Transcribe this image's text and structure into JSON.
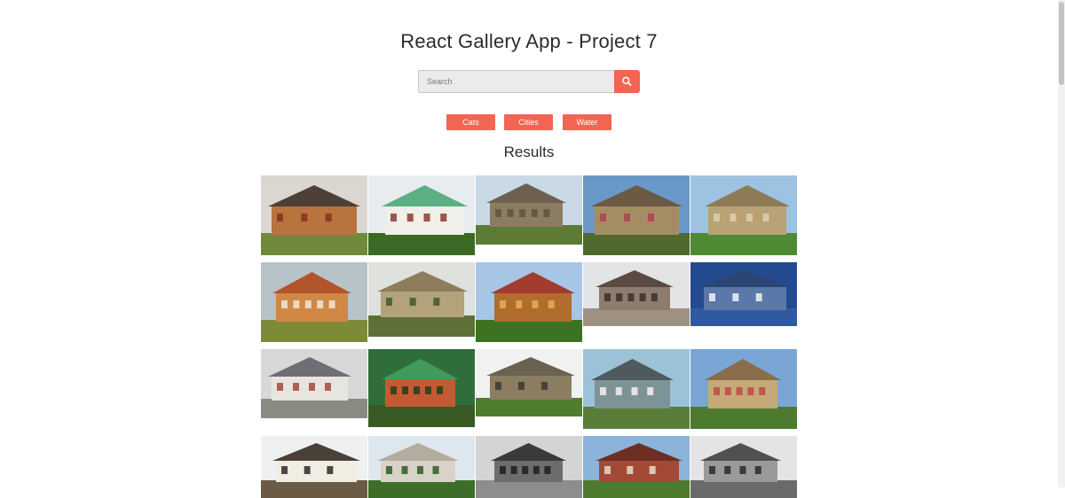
{
  "header": {
    "title": "React Gallery App - Project 7"
  },
  "search": {
    "placeholder": "Search",
    "value": "",
    "button_icon": "search-icon"
  },
  "nav": {
    "links": [
      "Cats",
      "Cities",
      "Water"
    ]
  },
  "results": {
    "heading": "Results"
  },
  "colors": {
    "accent": "#f36452",
    "text": "#2c2c2c",
    "input_bg": "#ebebeb"
  },
  "gallery": {
    "photos": [
      {
        "name": "photo-cottage-thatched",
        "palette": {
          "sky": "#d9d7cf",
          "wall": "#b8733f",
          "roof": "#4e4038",
          "ground": "#6f8a3d",
          "accent": "#8a2f22"
        }
      },
      {
        "name": "photo-house-green-roof",
        "palette": {
          "sky": "#e8ecef",
          "wall": "#f0efe9",
          "roof": "#5bb083",
          "ground": "#3c6a24",
          "accent": "#8d3b33"
        }
      },
      {
        "name": "photo-manor-stone",
        "palette": {
          "sky": "#c9d9e6",
          "wall": "#8c7d62",
          "roof": "#6c6150",
          "ground": "#5d7b35",
          "accent": "#5c5444"
        }
      },
      {
        "name": "photo-mansion-garden",
        "palette": {
          "sky": "#6a98c9",
          "wall": "#a58d63",
          "roof": "#6b5a44",
          "ground": "#4f6a2c",
          "accent": "#b23f52"
        }
      },
      {
        "name": "photo-hall-lawn",
        "palette": {
          "sky": "#9ec2e2",
          "wall": "#b9a273",
          "roof": "#8e7a55",
          "ground": "#4f8a34",
          "accent": "#d9cfb6"
        }
      },
      {
        "name": "photo-house-red-roof",
        "palette": {
          "sky": "#b8c3c8",
          "wall": "#d08844",
          "roof": "#b2542c",
          "ground": "#7d8a38",
          "accent": "#f0e8dc"
        }
      },
      {
        "name": "photo-palace-terrace",
        "palette": {
          "sky": "#dfe1dc",
          "wall": "#b4a27c",
          "roof": "#8d7d5d",
          "ground": "#5d7035",
          "accent": "#3d5a26"
        }
      },
      {
        "name": "photo-chalet-wooden",
        "palette": {
          "sky": "#a7c6e6",
          "wall": "#b26c2e",
          "roof": "#a23c2e",
          "ground": "#3d7223",
          "accent": "#e0b055"
        }
      },
      {
        "name": "photo-ruin-brick",
        "palette": {
          "sky": "#e2e4e6",
          "wall": "#8e7c6e",
          "roof": "#5a4a42",
          "ground": "#9f9181",
          "accent": "#37312c"
        }
      },
      {
        "name": "photo-beach-house-blue",
        "palette": {
          "sky": "#234a8d",
          "wall": "#5a78a8",
          "roof": "#2d4574",
          "ground": "#2f5aa0",
          "accent": "#f2f3f5"
        }
      },
      {
        "name": "photo-village-roofs",
        "palette": {
          "sky": "#d8d9d7",
          "wall": "#e7e5df",
          "roof": "#6e6e74",
          "ground": "#8a8a82",
          "accent": "#a64a3c"
        }
      },
      {
        "name": "photo-house-green-shingle",
        "palette": {
          "sky": "#2f6e3b",
          "wall": "#c45a33",
          "roof": "#3f9a5b",
          "ground": "#3a5a25",
          "accent": "#263e1a"
        }
      },
      {
        "name": "photo-estate-distant",
        "palette": {
          "sky": "#f0f1f1",
          "wall": "#8a7d60",
          "roof": "#6b6150",
          "ground": "#4f7d2e",
          "accent": "#3a3a30"
        }
      },
      {
        "name": "photo-house-grey-siding",
        "palette": {
          "sky": "#9cc2d8",
          "wall": "#7e9398",
          "roof": "#4e5a5e",
          "ground": "#5b7d3a",
          "accent": "#f1f2ee"
        }
      },
      {
        "name": "photo-tudor-mansion",
        "palette": {
          "sky": "#7aa6d6",
          "wall": "#c6a978",
          "roof": "#8a6e4c",
          "ground": "#4d7a2e",
          "accent": "#c04848"
        }
      },
      {
        "name": "photo-tudor-cottage",
        "palette": {
          "sky": "#eef0f1",
          "wall": "#f2ede2",
          "roof": "#4a4038",
          "ground": "#6b5a45",
          "accent": "#2e2a26"
        }
      },
      {
        "name": "photo-castle-white",
        "palette": {
          "sky": "#dfe7ee",
          "wall": "#d8d3c6",
          "roof": "#b3ad9f",
          "ground": "#3c6e2a",
          "accent": "#2e5a23"
        }
      },
      {
        "name": "photo-log-cabin",
        "palette": {
          "sky": "#d4d4d4",
          "wall": "#6d6d6d",
          "roof": "#3a3a3a",
          "ground": "#8d8d8d",
          "accent": "#1f1f1f"
        }
      },
      {
        "name": "photo-brick-hall",
        "palette": {
          "sky": "#8cb3d9",
          "wall": "#a24a36",
          "roof": "#6d2f24",
          "ground": "#4f7a2e",
          "accent": "#e5dccb"
        }
      },
      {
        "name": "photo-barn-bw",
        "palette": {
          "sky": "#e4e4e4",
          "wall": "#9a9a9a",
          "roof": "#505050",
          "ground": "#6a6a6a",
          "accent": "#2a2a2a"
        }
      }
    ]
  }
}
